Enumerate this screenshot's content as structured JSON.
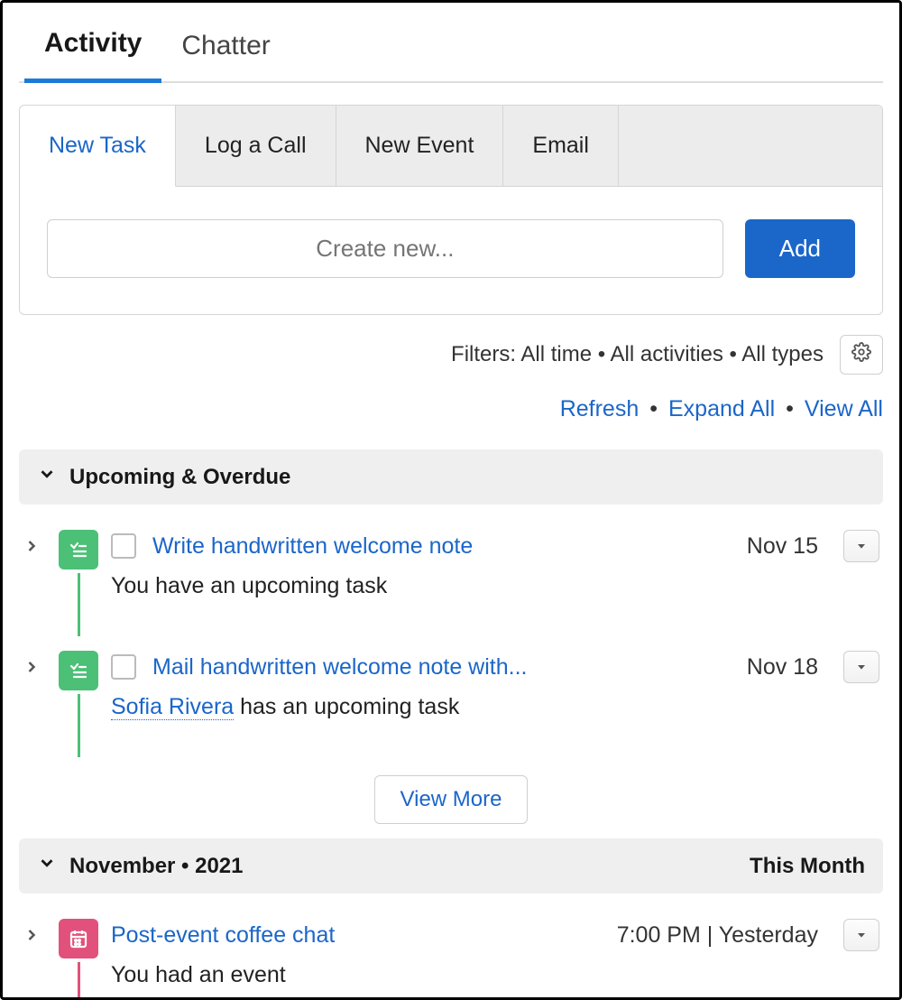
{
  "top_tabs": {
    "activity": "Activity",
    "chatter": "Chatter"
  },
  "action_tabs": {
    "new_task": "New Task",
    "log_call": "Log a Call",
    "new_event": "New Event",
    "email": "Email"
  },
  "create": {
    "placeholder": "Create new...",
    "add_label": "Add"
  },
  "filters": {
    "prefix": "Filters:",
    "time": "All time",
    "activities": "All activities",
    "types": "All types"
  },
  "links": {
    "refresh": "Refresh",
    "expand_all": "Expand All",
    "view_all": "View All"
  },
  "sections": {
    "upcoming": {
      "title": "Upcoming & Overdue"
    },
    "month": {
      "title": "November • 2021",
      "badge": "This Month"
    }
  },
  "items": {
    "t1": {
      "title": "Write handwritten welcome note",
      "date": "Nov 15",
      "desc": "You have an upcoming task"
    },
    "t2": {
      "title": "Mail handwritten welcome note with...",
      "date": "Nov 18",
      "person": "Sofia Rivera",
      "desc_suffix": " has an upcoming task"
    },
    "e1": {
      "title": "Post-event coffee chat",
      "date": "7:00 PM | Yesterday",
      "desc": "You had an event"
    }
  },
  "buttons": {
    "view_more": "View More"
  }
}
